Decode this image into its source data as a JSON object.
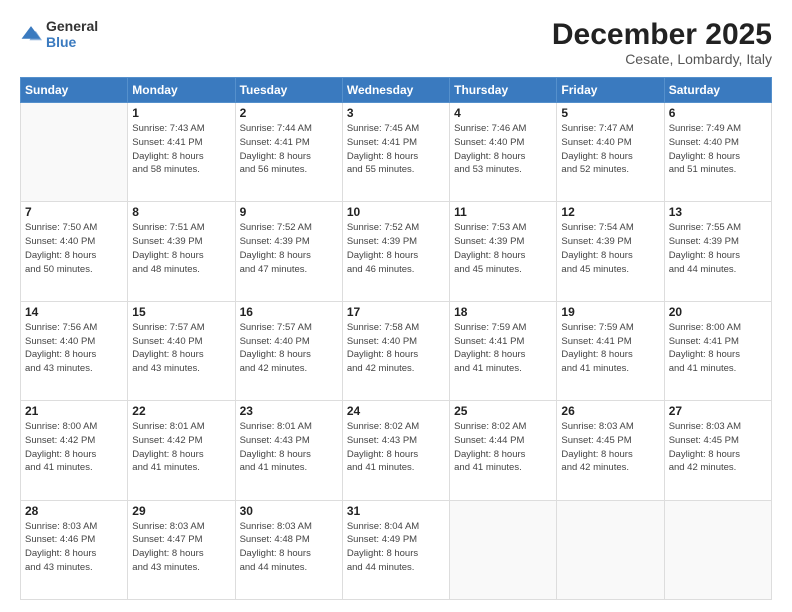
{
  "logo": {
    "general": "General",
    "blue": "Blue"
  },
  "header": {
    "month": "December 2025",
    "location": "Cesate, Lombardy, Italy"
  },
  "days_of_week": [
    "Sunday",
    "Monday",
    "Tuesday",
    "Wednesday",
    "Thursday",
    "Friday",
    "Saturday"
  ],
  "weeks": [
    [
      {
        "day": "",
        "info": ""
      },
      {
        "day": "1",
        "info": "Sunrise: 7:43 AM\nSunset: 4:41 PM\nDaylight: 8 hours\nand 58 minutes."
      },
      {
        "day": "2",
        "info": "Sunrise: 7:44 AM\nSunset: 4:41 PM\nDaylight: 8 hours\nand 56 minutes."
      },
      {
        "day": "3",
        "info": "Sunrise: 7:45 AM\nSunset: 4:41 PM\nDaylight: 8 hours\nand 55 minutes."
      },
      {
        "day": "4",
        "info": "Sunrise: 7:46 AM\nSunset: 4:40 PM\nDaylight: 8 hours\nand 53 minutes."
      },
      {
        "day": "5",
        "info": "Sunrise: 7:47 AM\nSunset: 4:40 PM\nDaylight: 8 hours\nand 52 minutes."
      },
      {
        "day": "6",
        "info": "Sunrise: 7:49 AM\nSunset: 4:40 PM\nDaylight: 8 hours\nand 51 minutes."
      }
    ],
    [
      {
        "day": "7",
        "info": "Sunrise: 7:50 AM\nSunset: 4:40 PM\nDaylight: 8 hours\nand 50 minutes."
      },
      {
        "day": "8",
        "info": "Sunrise: 7:51 AM\nSunset: 4:39 PM\nDaylight: 8 hours\nand 48 minutes."
      },
      {
        "day": "9",
        "info": "Sunrise: 7:52 AM\nSunset: 4:39 PM\nDaylight: 8 hours\nand 47 minutes."
      },
      {
        "day": "10",
        "info": "Sunrise: 7:52 AM\nSunset: 4:39 PM\nDaylight: 8 hours\nand 46 minutes."
      },
      {
        "day": "11",
        "info": "Sunrise: 7:53 AM\nSunset: 4:39 PM\nDaylight: 8 hours\nand 45 minutes."
      },
      {
        "day": "12",
        "info": "Sunrise: 7:54 AM\nSunset: 4:39 PM\nDaylight: 8 hours\nand 45 minutes."
      },
      {
        "day": "13",
        "info": "Sunrise: 7:55 AM\nSunset: 4:39 PM\nDaylight: 8 hours\nand 44 minutes."
      }
    ],
    [
      {
        "day": "14",
        "info": "Sunrise: 7:56 AM\nSunset: 4:40 PM\nDaylight: 8 hours\nand 43 minutes."
      },
      {
        "day": "15",
        "info": "Sunrise: 7:57 AM\nSunset: 4:40 PM\nDaylight: 8 hours\nand 43 minutes."
      },
      {
        "day": "16",
        "info": "Sunrise: 7:57 AM\nSunset: 4:40 PM\nDaylight: 8 hours\nand 42 minutes."
      },
      {
        "day": "17",
        "info": "Sunrise: 7:58 AM\nSunset: 4:40 PM\nDaylight: 8 hours\nand 42 minutes."
      },
      {
        "day": "18",
        "info": "Sunrise: 7:59 AM\nSunset: 4:41 PM\nDaylight: 8 hours\nand 41 minutes."
      },
      {
        "day": "19",
        "info": "Sunrise: 7:59 AM\nSunset: 4:41 PM\nDaylight: 8 hours\nand 41 minutes."
      },
      {
        "day": "20",
        "info": "Sunrise: 8:00 AM\nSunset: 4:41 PM\nDaylight: 8 hours\nand 41 minutes."
      }
    ],
    [
      {
        "day": "21",
        "info": "Sunrise: 8:00 AM\nSunset: 4:42 PM\nDaylight: 8 hours\nand 41 minutes."
      },
      {
        "day": "22",
        "info": "Sunrise: 8:01 AM\nSunset: 4:42 PM\nDaylight: 8 hours\nand 41 minutes."
      },
      {
        "day": "23",
        "info": "Sunrise: 8:01 AM\nSunset: 4:43 PM\nDaylight: 8 hours\nand 41 minutes."
      },
      {
        "day": "24",
        "info": "Sunrise: 8:02 AM\nSunset: 4:43 PM\nDaylight: 8 hours\nand 41 minutes."
      },
      {
        "day": "25",
        "info": "Sunrise: 8:02 AM\nSunset: 4:44 PM\nDaylight: 8 hours\nand 41 minutes."
      },
      {
        "day": "26",
        "info": "Sunrise: 8:03 AM\nSunset: 4:45 PM\nDaylight: 8 hours\nand 42 minutes."
      },
      {
        "day": "27",
        "info": "Sunrise: 8:03 AM\nSunset: 4:45 PM\nDaylight: 8 hours\nand 42 minutes."
      }
    ],
    [
      {
        "day": "28",
        "info": "Sunrise: 8:03 AM\nSunset: 4:46 PM\nDaylight: 8 hours\nand 43 minutes."
      },
      {
        "day": "29",
        "info": "Sunrise: 8:03 AM\nSunset: 4:47 PM\nDaylight: 8 hours\nand 43 minutes."
      },
      {
        "day": "30",
        "info": "Sunrise: 8:03 AM\nSunset: 4:48 PM\nDaylight: 8 hours\nand 44 minutes."
      },
      {
        "day": "31",
        "info": "Sunrise: 8:04 AM\nSunset: 4:49 PM\nDaylight: 8 hours\nand 44 minutes."
      },
      {
        "day": "",
        "info": ""
      },
      {
        "day": "",
        "info": ""
      },
      {
        "day": "",
        "info": ""
      }
    ]
  ]
}
